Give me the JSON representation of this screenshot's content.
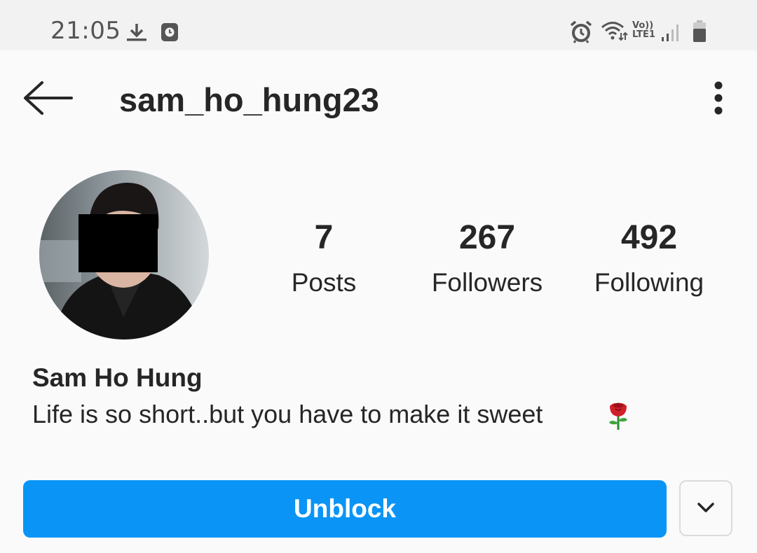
{
  "status_bar": {
    "time": "21:05",
    "network_label": "Vo)) LTE1",
    "icons": [
      "download-icon",
      "clock-notification-icon",
      "alarm-icon",
      "wifi-icon",
      "signal-icon",
      "battery-icon"
    ]
  },
  "header": {
    "username": "sam_ho_hung23",
    "icons": [
      "back-arrow-icon",
      "more-options-icon"
    ]
  },
  "profile": {
    "stats": [
      {
        "value": "7",
        "label": "Posts"
      },
      {
        "value": "267",
        "label": "Followers"
      },
      {
        "value": "492",
        "label": "Following"
      }
    ],
    "full_name": "Sam Ho Hung",
    "bio": "Life is so short..but you have to make it sweet",
    "bio_emoji": "rose-emoji"
  },
  "actions": {
    "unblock_label": "Unblock",
    "dropdown_icon": "chevron-down-icon"
  },
  "colors": {
    "accent": "#0a95f6",
    "background": "#fafafa",
    "status_bar": "#f2f2f2",
    "text": "#262626"
  }
}
